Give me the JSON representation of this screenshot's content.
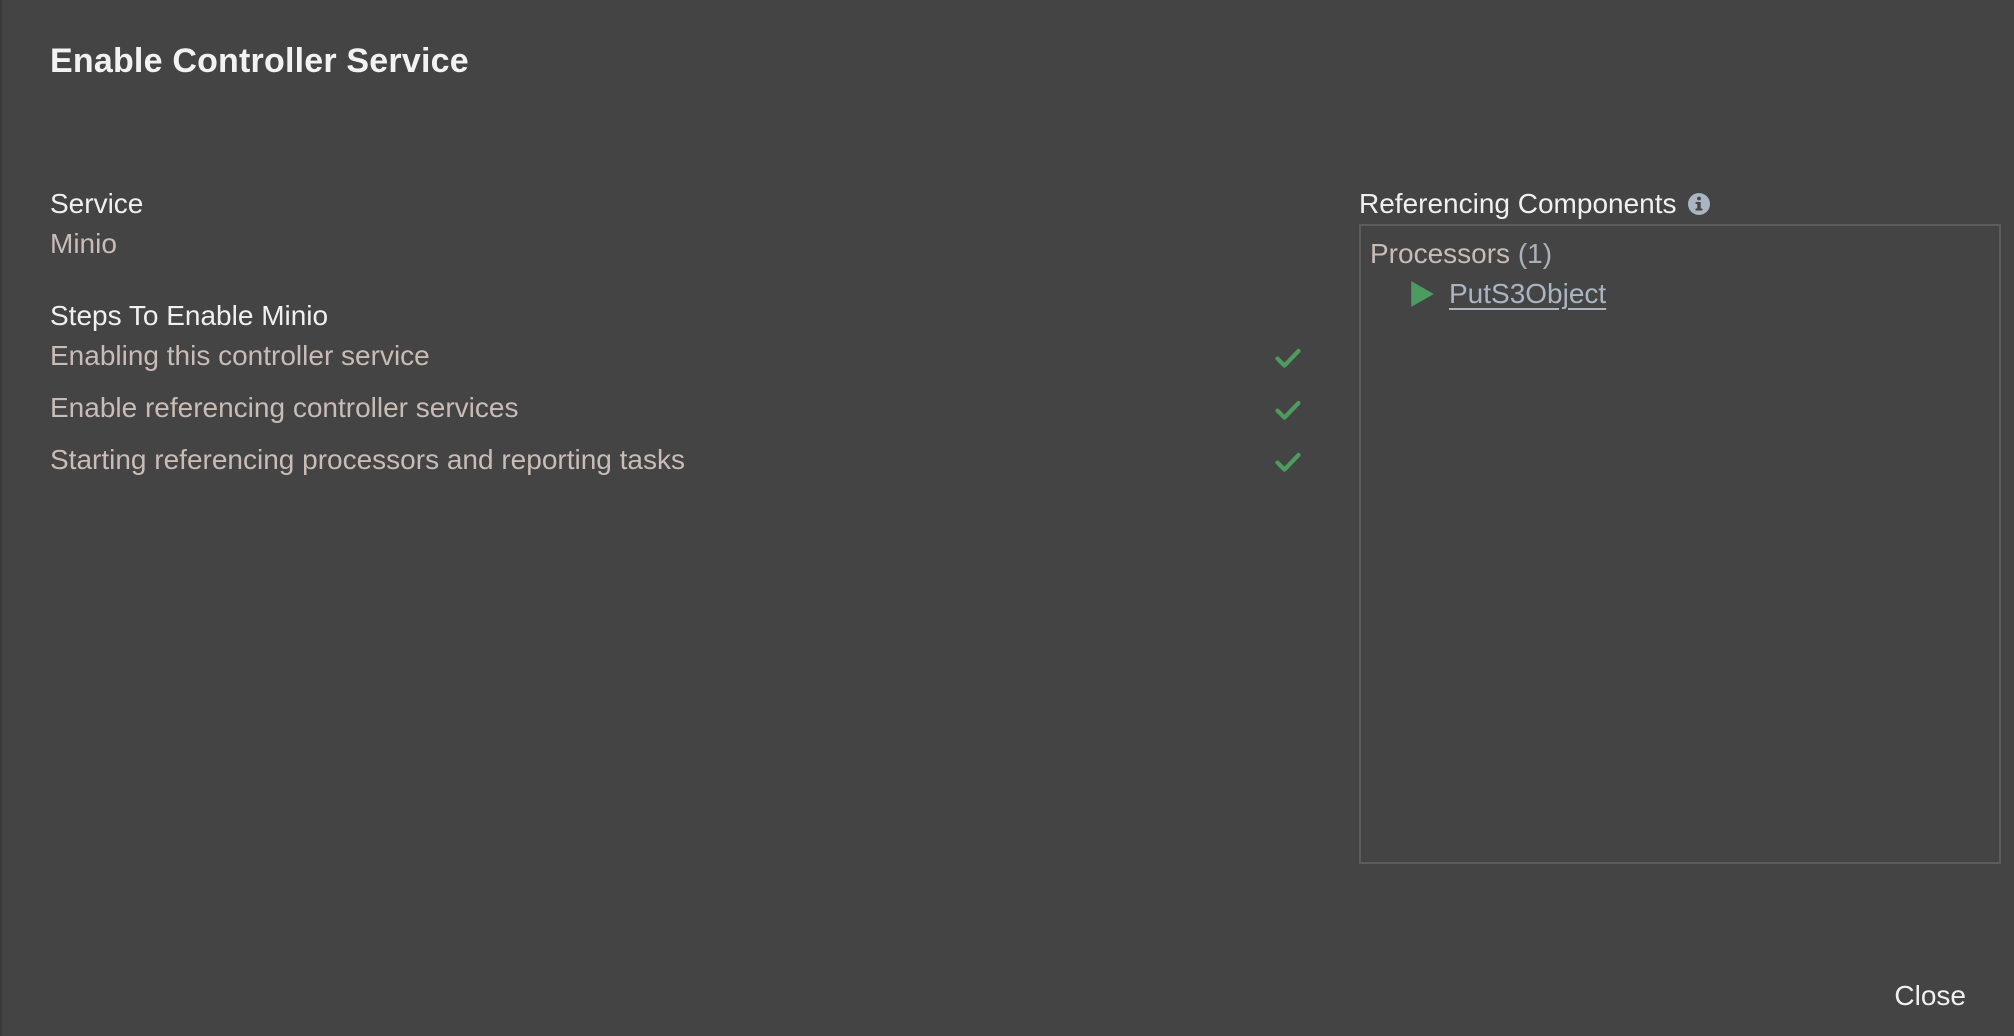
{
  "dialog": {
    "title": "Enable Controller Service",
    "close_label": "Close"
  },
  "service": {
    "label": "Service",
    "value": "Minio"
  },
  "steps": {
    "label": "Steps To Enable Minio",
    "items": [
      {
        "text": "Enabling this controller service",
        "status": "check-icon"
      },
      {
        "text": "Enable referencing controller services",
        "status": "check-icon"
      },
      {
        "text": "Starting referencing processors and reporting tasks",
        "status": "check-icon"
      }
    ]
  },
  "referencing": {
    "label": "Referencing Components",
    "info_icon": "info-icon",
    "groups": [
      {
        "name": "Processors",
        "count": "(1)",
        "items": [
          {
            "name": "PutS3Object",
            "state_icon": "play-icon"
          }
        ]
      }
    ]
  },
  "colors": {
    "background": "#444444",
    "title": "#f2f2f2",
    "muted_text": "#c9bcb6",
    "link": "#a9b5c2",
    "success": "#4d9b5f"
  }
}
